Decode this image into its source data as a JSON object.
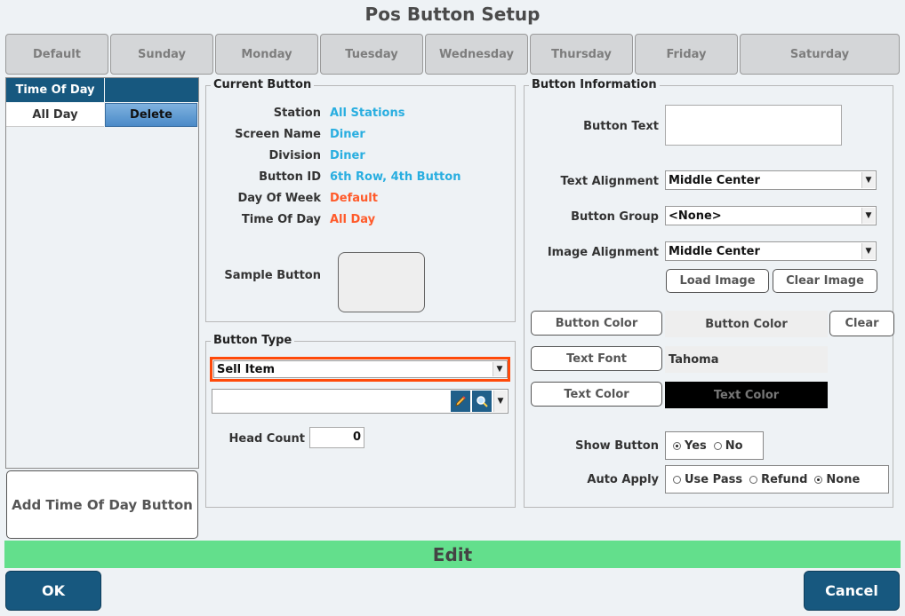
{
  "window": {
    "title": "Pos Button Setup"
  },
  "day_tabs": [
    "Default",
    "Sunday",
    "Monday",
    "Tuesday",
    "Wednesday",
    "Thursday",
    "Friday",
    "Saturday"
  ],
  "time_of_day": {
    "header": "Time Of Day",
    "header2": "",
    "rows": [
      {
        "name": "All Day",
        "action": "Delete"
      }
    ],
    "add_button": "Add Time Of Day Button"
  },
  "current_button": {
    "title": "Current Button",
    "fields": [
      {
        "label": "Station",
        "value": "All Stations",
        "color": "#29aee0"
      },
      {
        "label": "Screen Name",
        "value": "Diner",
        "color": "#29aee0"
      },
      {
        "label": "Division",
        "value": "Diner",
        "color": "#29aee0"
      },
      {
        "label": "Button ID",
        "value": "6th Row, 4th Button",
        "color": "#29aee0"
      },
      {
        "label": "Day Of Week",
        "value": "Default",
        "color": "#ff5a2a"
      },
      {
        "label": "Time Of Day",
        "value": "All Day",
        "color": "#ff5a2a"
      }
    ],
    "sample_label": "Sample Button"
  },
  "button_type": {
    "title": "Button Type",
    "type_value": "Sell Item",
    "item_value": "",
    "head_count_label": "Head Count",
    "head_count_value": "0"
  },
  "button_info": {
    "title": "Button Information",
    "text_label": "Button Text",
    "text_value": "",
    "text_align_label": "Text Alignment",
    "text_align_value": "Middle Center",
    "group_label": "Button Group",
    "group_value": "<None>",
    "image_align_label": "Image Alignment",
    "image_align_value": "Middle Center",
    "load_image": "Load Image",
    "clear_image": "Clear Image",
    "button_color_btn": "Button Color",
    "button_color_preview": "Button Color",
    "clear_btn": "Clear",
    "text_font_btn": "Text Font",
    "text_font_value": "Tahoma",
    "text_color_btn": "Text Color",
    "text_color_preview": "Text Color",
    "show_button_label": "Show Button",
    "show_yes": "Yes",
    "show_no": "No",
    "auto_apply_label": "Auto Apply",
    "auto_use_pass": "Use Pass",
    "auto_refund": "Refund",
    "auto_none": "None"
  },
  "footer": {
    "edit_label": "Edit",
    "ok": "OK",
    "cancel": "Cancel"
  },
  "colors": {
    "accent": "#17587f",
    "highlight": "#ff4a0a",
    "edit_bar": "#63df8c"
  }
}
